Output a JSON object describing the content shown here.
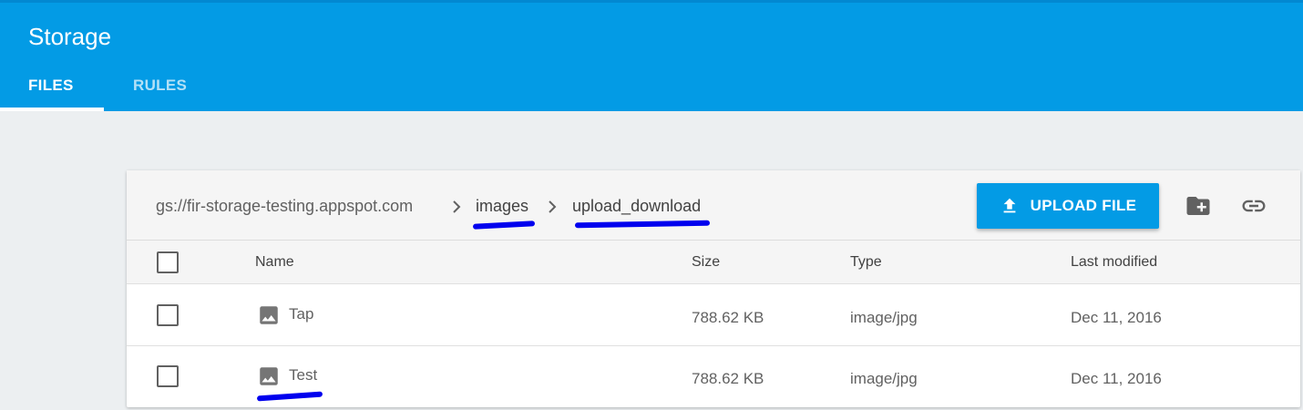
{
  "header": {
    "title": "Storage",
    "tabs": [
      {
        "label": "FILES",
        "active": true
      },
      {
        "label": "RULES",
        "active": false
      }
    ]
  },
  "breadcrumb": {
    "root": "gs://fir-storage-testing.appspot.com",
    "items": [
      "images",
      "upload_download"
    ]
  },
  "toolbar": {
    "upload_label": "UPLOAD FILE",
    "icons": [
      "upload-icon",
      "create-folder-icon",
      "link-icon"
    ]
  },
  "table": {
    "columns": [
      "Name",
      "Size",
      "Type",
      "Last modified"
    ],
    "rows": [
      {
        "name": "Tap",
        "size": "788.62 KB",
        "type": "image/jpg",
        "modified": "Dec 11, 2016"
      },
      {
        "name": "Test",
        "size": "788.62 KB",
        "type": "image/jpg",
        "modified": "Dec 11, 2016"
      }
    ]
  },
  "colors": {
    "brand": "#039be5",
    "annotation": "#0000ee",
    "background": "#eceff1"
  }
}
